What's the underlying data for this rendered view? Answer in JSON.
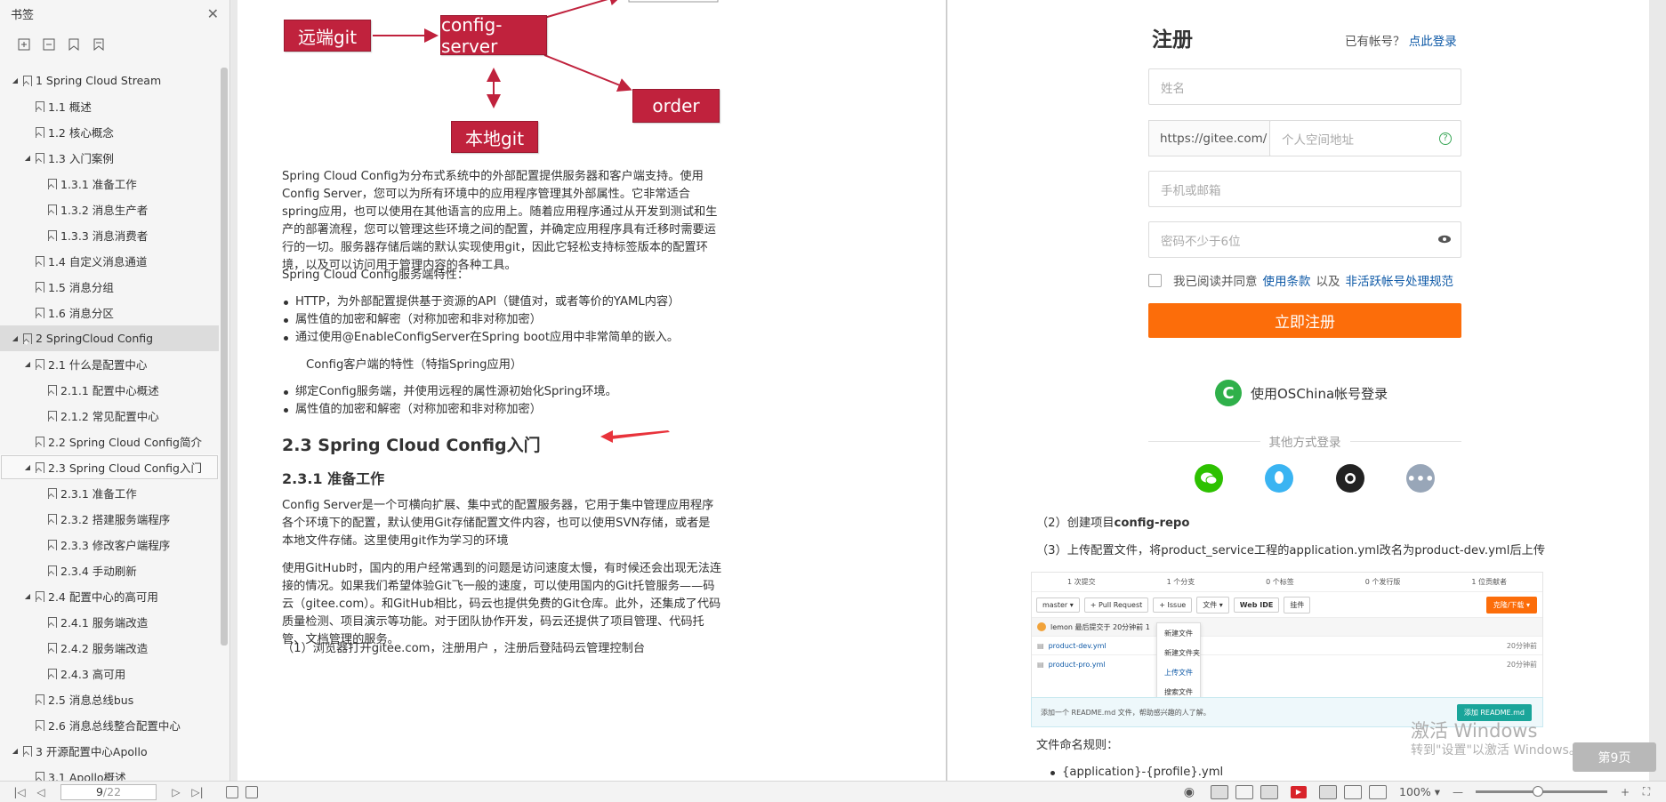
{
  "sidebar": {
    "title": "书签",
    "items": [
      {
        "label": "1 Spring Cloud Stream",
        "level": 0,
        "toggle": "◢"
      },
      {
        "label": "1.1 概述",
        "level": 1,
        "toggle": ""
      },
      {
        "label": "1.2 核心概念",
        "level": 1,
        "toggle": ""
      },
      {
        "label": "1.3 入门案例",
        "level": 1,
        "toggle": "◢"
      },
      {
        "label": "1.3.1 准备工作",
        "level": 2,
        "toggle": ""
      },
      {
        "label": "1.3.2 消息生产者",
        "level": 2,
        "toggle": ""
      },
      {
        "label": "1.3.3 消息消费者",
        "level": 2,
        "toggle": ""
      },
      {
        "label": "1.4 自定义消息通道",
        "level": 1,
        "toggle": ""
      },
      {
        "label": "1.5 消息分组",
        "level": 1,
        "toggle": ""
      },
      {
        "label": "1.6 消息分区",
        "level": 1,
        "toggle": ""
      },
      {
        "label": "2 SpringCloud Config",
        "level": 0,
        "toggle": "◢",
        "state": "selected"
      },
      {
        "label": "2.1 什么是配置中心",
        "level": 1,
        "toggle": "◢"
      },
      {
        "label": "2.1.1 配置中心概述",
        "level": 2,
        "toggle": ""
      },
      {
        "label": "2.1.2 常见配置中心",
        "level": 2,
        "toggle": ""
      },
      {
        "label": "2.2 Spring Cloud Config简介",
        "level": 1,
        "toggle": ""
      },
      {
        "label": "2.3 Spring Cloud Config入门",
        "level": 1,
        "toggle": "◢",
        "state": "boxed"
      },
      {
        "label": "2.3.1 准备工作",
        "level": 2,
        "toggle": ""
      },
      {
        "label": "2.3.2 搭建服务端程序",
        "level": 2,
        "toggle": ""
      },
      {
        "label": "2.3.3 修改客户端程序",
        "level": 2,
        "toggle": ""
      },
      {
        "label": "2.3.4 手动刷新",
        "level": 2,
        "toggle": ""
      },
      {
        "label": "2.4 配置中心的高可用",
        "level": 1,
        "toggle": "◢"
      },
      {
        "label": "2.4.1 服务端改造",
        "level": 2,
        "toggle": ""
      },
      {
        "label": "2.4.2 服务端改造",
        "level": 2,
        "toggle": ""
      },
      {
        "label": "2.4.3 高可用",
        "level": 2,
        "toggle": ""
      },
      {
        "label": "2.5 消息总线bus",
        "level": 1,
        "toggle": ""
      },
      {
        "label": "2.6 消息总线整合配置中心",
        "level": 1,
        "toggle": ""
      },
      {
        "label": "3 开源配置中心Apollo",
        "level": 0,
        "toggle": "◢"
      },
      {
        "label": "3.1 Apollo概述",
        "level": 1,
        "toggle": ""
      }
    ]
  },
  "diagram": {
    "remote_git": "远端git",
    "config_server": "config-server",
    "order": "order",
    "local_git": "本地git"
  },
  "left_page": {
    "intro": "Spring Cloud Config为分布式系统中的外部配置提供服务器和客户端支持。使用Config Server，您可以为所有环境中的应用程序管理其外部属性。它非常适合spring应用，也可以使用在其他语言的应用上。随着应用程序通过从开发到测试和生产的部署流程，您可以管理这些环境之间的配置，并确定应用程序具有迁移时需要运行的一切。服务器存储后端的默认实现使用git，因此它轻松支持标签版本的配置环境，以及可以访问用于管理内容的各种工具。",
    "server_features_title": "Spring Cloud Config服务端特性：",
    "server_features": [
      "HTTP，为外部配置提供基于资源的API（键值对，或者等价的YAML内容）",
      "属性值的加密和解密（对称加密和非对称加密）",
      "通过使用@EnableConfigServer在Spring boot应用中非常简单的嵌入。"
    ],
    "client_features_title": "Config客户端的特性（特指Spring应用）",
    "client_features": [
      "绑定Config服务端，并使用远程的属性源初始化Spring环境。",
      "属性值的加密和解密（对称加密和非对称加密）"
    ],
    "h2": "2.3 Spring Cloud Config入门",
    "h3": "2.3.1 准备工作",
    "para1": "Config Server是一个可横向扩展、集中式的配置服务器，它用于集中管理应用程序各个环境下的配置，默认使用Git存储配置文件内容，也可以使用SVN存储，或者是本地文件存储。这里使用git作为学习的环境",
    "para2": "使用GitHub时，国内的用户经常遇到的问题是访问速度太慢，有时候还会出现无法连接的情况。如果我们希望体验Git飞一般的速度，可以使用国内的Git托管服务——码云（gitee.com）。和GitHub相比，码云也提供免费的Git仓库。此外，还集成了代码质量检测、项目演示等功能。对于团队协作开发，码云还提供了项目管理、代码托管、文档管理的服务。",
    "step1": "（1）浏览器打开gitee.com，注册用户 ，注册后登陆码云管理控制台"
  },
  "register": {
    "title": "注册",
    "have_account": "已有帐号？",
    "login_link": "点此登录",
    "name_placeholder": "姓名",
    "url_prefix": "https://gitee.com/",
    "space_placeholder": "个人空间地址",
    "phone_placeholder": "手机或邮箱",
    "password_placeholder": "密码不少于6位",
    "agree_text": "我已阅读并同意",
    "terms_link": "使用条款",
    "and_text": "以及",
    "inactive_link": "非活跃帐号处理规范",
    "submit": "立即注册",
    "oschina_login": "使用OSChina帐号登录",
    "other_login": "其他方式登录"
  },
  "right_page": {
    "step2_prefix": "（2）创建项目",
    "step2_bold": "config-repo",
    "step3": "（3）上传配置文件，将product_service工程的application.yml改名为product-dev.yml后上传",
    "naming_rule": "文件命名规则：",
    "bullet1": "{application}-{profile}.yml"
  },
  "embedded": {
    "stats": [
      "1 次提交",
      "1 个分支",
      "0 个标签",
      "0 个发行版",
      "1 位贡献者"
    ],
    "branch": "master ▾",
    "pull_request": "+ Pull Request",
    "issue": "+ Issue",
    "file_menu": "文件 ▾",
    "web_ide": "Web IDE",
    "attach": "挂件",
    "clone": "克隆/下载 ▾",
    "commit_row": "lemon 最后提交于 20分钟前 1",
    "files": [
      {
        "name": "product-dev.yml",
        "time": "20分钟前"
      },
      {
        "name": "product-pro.yml",
        "time": "20分钟前"
      }
    ],
    "menu": [
      "新建文件",
      "新建文件夹",
      "上传文件",
      "搜索文件"
    ],
    "readme_tip": "添加一个 README.md 文件，帮助感兴趣的人了解。",
    "readme_btn": "添加 README.md"
  },
  "watermark": {
    "line1": "激活 Windows",
    "line2": "转到\"设置\"以激活 Windows。"
  },
  "page_badge": "第9页",
  "status_bar": {
    "current_page": "9",
    "total_pages": "/22",
    "zoom": "100%",
    "zoom_fraction": 0.47
  },
  "colors": {
    "diagram_red": "#c0223d",
    "gitee_orange": "#fc6d0a",
    "link_blue": "#0f5aa7",
    "wechat_green": "#2dc100",
    "qq_blue": "#3ab4f2",
    "more_gray": "#98a6b8",
    "arrow_red": "#e8333b"
  }
}
